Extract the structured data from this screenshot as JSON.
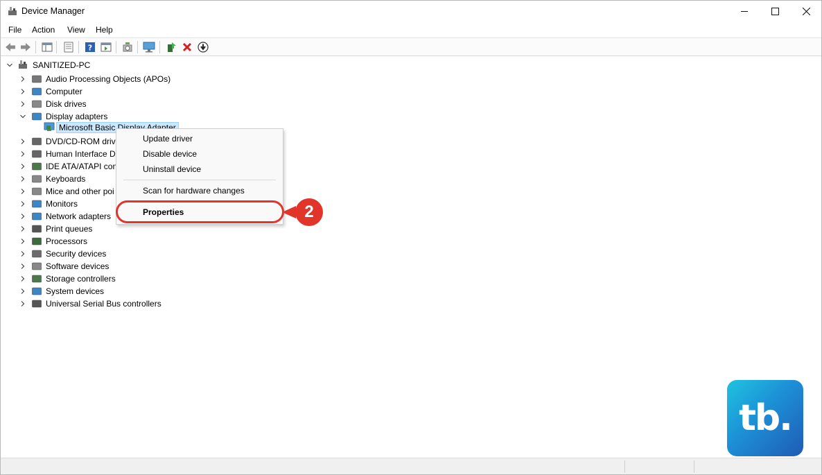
{
  "window": {
    "title": "Device Manager",
    "minimize": "—",
    "maximize": "☐",
    "close": "✕"
  },
  "menu": [
    "File",
    "Action",
    "View",
    "Help"
  ],
  "toolbar": {
    "icons": [
      "back-arrow-icon",
      "forward-arrow-icon",
      "show-hide-console-tree-icon",
      "properties-sheet-icon",
      "help-icon",
      "action-pane-icon",
      "scan-hardware-icon",
      "monitor-icon",
      "update-driver-icon",
      "uninstall-device-icon",
      "disable-device-icon"
    ]
  },
  "tree": {
    "root": "SANITIZED-PC",
    "categories": [
      {
        "label": "Audio Processing Objects (APOs)",
        "expanded": false
      },
      {
        "label": "Computer",
        "expanded": false
      },
      {
        "label": "Disk drives",
        "expanded": false
      },
      {
        "label": "Display adapters",
        "expanded": true
      },
      {
        "label": "DVD/CD-ROM drive",
        "expanded": false
      },
      {
        "label": "Human Interface De",
        "expanded": false
      },
      {
        "label": "IDE ATA/ATAPI cont",
        "expanded": false
      },
      {
        "label": "Keyboards",
        "expanded": false
      },
      {
        "label": "Mice and other poi",
        "expanded": false
      },
      {
        "label": "Monitors",
        "expanded": false
      },
      {
        "label": "Network adapters",
        "expanded": false
      },
      {
        "label": "Print queues",
        "expanded": false
      },
      {
        "label": "Processors",
        "expanded": false
      },
      {
        "label": "Security devices",
        "expanded": false
      },
      {
        "label": "Software devices",
        "expanded": false
      },
      {
        "label": "Storage controllers",
        "expanded": false
      },
      {
        "label": "System devices",
        "expanded": false
      },
      {
        "label": "Universal Serial Bus controllers",
        "expanded": false
      }
    ],
    "selected_device": "Microsoft Basic Display Adapter"
  },
  "context_menu": {
    "items": [
      "Update driver",
      "Disable device",
      "Uninstall device",
      "Scan for hardware changes",
      "Properties"
    ],
    "highlighted": "Properties"
  },
  "callout": {
    "number": "2",
    "color": "#e1342b"
  },
  "logo": {
    "text": "tb."
  },
  "colors": {
    "selection": "#cce8ff",
    "accent": "#e1342b"
  }
}
